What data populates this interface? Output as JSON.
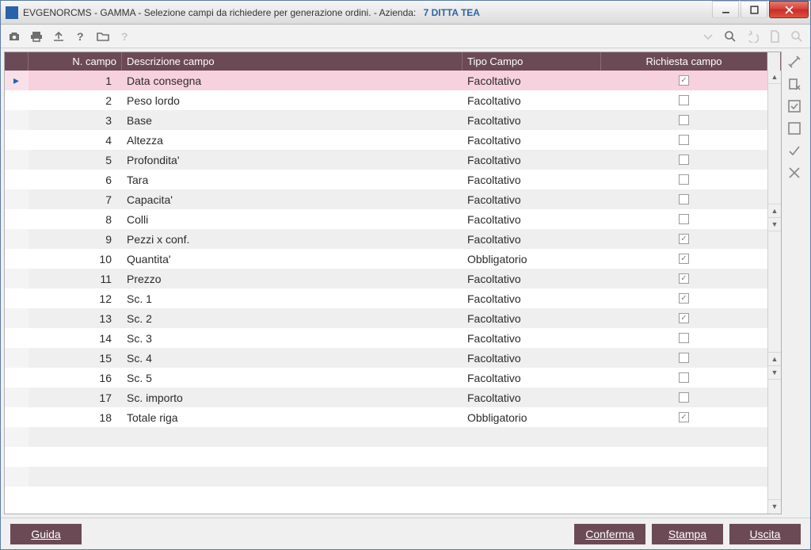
{
  "titlebar": {
    "module": "EVGENORCMS - GAMMA",
    "subtitle": "Selezione campi da richiedere per generazione ordini.",
    "company_label": "Azienda:",
    "company_num": "7",
    "company_name": "DITTA TEA"
  },
  "columns": {
    "num": "N. campo",
    "desc": "Descrizione campo",
    "tipo": "Tipo Campo",
    "rich": "Richiesta campo"
  },
  "rows": [
    {
      "n": "1",
      "desc": "Data consegna",
      "tipo": "Facoltativo",
      "checked": true,
      "selected": true
    },
    {
      "n": "2",
      "desc": "Peso lordo",
      "tipo": "Facoltativo",
      "checked": false
    },
    {
      "n": "3",
      "desc": "Base",
      "tipo": "Facoltativo",
      "checked": false
    },
    {
      "n": "4",
      "desc": "Altezza",
      "tipo": "Facoltativo",
      "checked": false
    },
    {
      "n": "5",
      "desc": "Profondita'",
      "tipo": "Facoltativo",
      "checked": false
    },
    {
      "n": "6",
      "desc": "Tara",
      "tipo": "Facoltativo",
      "checked": false
    },
    {
      "n": "7",
      "desc": "Capacita'",
      "tipo": "Facoltativo",
      "checked": false
    },
    {
      "n": "8",
      "desc": "Colli",
      "tipo": "Facoltativo",
      "checked": false
    },
    {
      "n": "9",
      "desc": "Pezzi x conf.",
      "tipo": "Facoltativo",
      "checked": true
    },
    {
      "n": "10",
      "desc": "Quantita'",
      "tipo": "Obbligatorio",
      "checked": true
    },
    {
      "n": "11",
      "desc": "Prezzo",
      "tipo": "Facoltativo",
      "checked": true
    },
    {
      "n": "12",
      "desc": "Sc. 1",
      "tipo": "Facoltativo",
      "checked": true
    },
    {
      "n": "13",
      "desc": "Sc. 2",
      "tipo": "Facoltativo",
      "checked": true
    },
    {
      "n": "14",
      "desc": "Sc. 3",
      "tipo": "Facoltativo",
      "checked": false
    },
    {
      "n": "15",
      "desc": "Sc. 4",
      "tipo": "Facoltativo",
      "checked": false
    },
    {
      "n": "16",
      "desc": "Sc. 5",
      "tipo": "Facoltativo",
      "checked": false
    },
    {
      "n": "17",
      "desc": "Sc. importo",
      "tipo": "Facoltativo",
      "checked": false
    },
    {
      "n": "18",
      "desc": "Totale riga",
      "tipo": "Obbligatorio",
      "checked": true
    }
  ],
  "empty_rows": 4,
  "footer": {
    "guida": "Guida",
    "conferma": "Conferma",
    "stampa": "Stampa",
    "uscita": "Uscita"
  }
}
